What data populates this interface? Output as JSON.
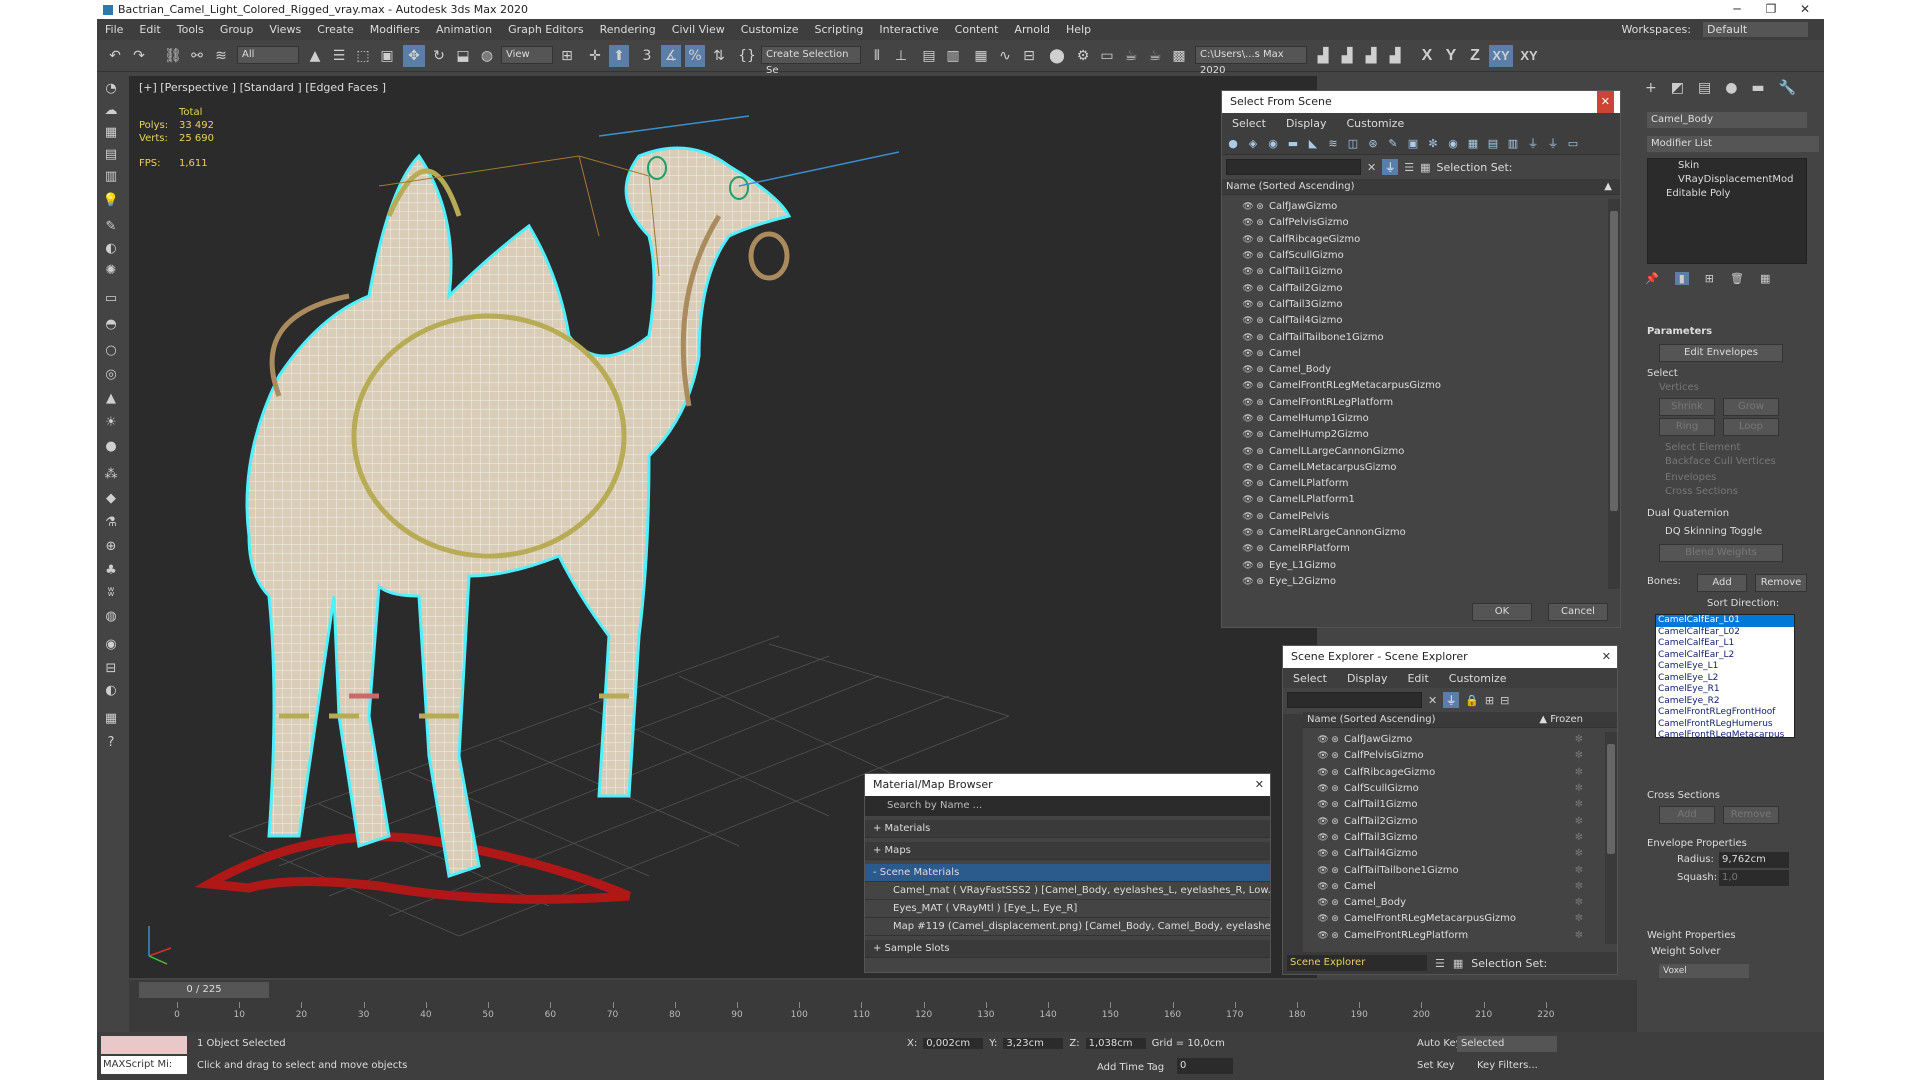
{
  "window": {
    "title": "Bactrian_Camel_Light_Colored_Rigged_vray.max - Autodesk 3ds Max 2020",
    "min": "─",
    "max": "❐",
    "close": "✕"
  },
  "menu": [
    "File",
    "Edit",
    "Tools",
    "Group",
    "Views",
    "Create",
    "Modifiers",
    "Animation",
    "Graph Editors",
    "Rendering",
    "Civil View",
    "Customize",
    "Scripting",
    "Interactive",
    "Content",
    "Arnold",
    "Help"
  ],
  "workspace": {
    "label": "Workspaces:",
    "value": "Default"
  },
  "toolbar": {
    "filter": "All",
    "refcoord": "View",
    "selset": "Create Selection Se",
    "path": "C:\\Users\\...s Max 2020",
    "axes": [
      "X",
      "Y",
      "Z",
      "XY",
      "XY"
    ]
  },
  "viewport": {
    "label": "[+] [Perspective ] [Standard ] [Edged Faces ]",
    "stats": {
      "total": "Total",
      "polys_k": "Polys:",
      "polys": "33 492",
      "verts_k": "Verts:",
      "verts": "25 690",
      "fps_k": "FPS:",
      "fps": "1,611"
    }
  },
  "select_from_scene": {
    "title": "Select From Scene",
    "menu": [
      "Select",
      "Display",
      "Customize"
    ],
    "selection_set": "Selection Set:",
    "col": "Name (Sorted Ascending)",
    "ok": "OK",
    "cancel": "Cancel",
    "items": [
      "CalfJawGizmo",
      "CalfPelvisGizmo",
      "CalfRibcageGizmo",
      "CalfScullGizmo",
      "CalfTail1Gizmo",
      "CalfTail2Gizmo",
      "CalfTail3Gizmo",
      "CalfTail4Gizmo",
      "CalfTailTailbone1Gizmo",
      "Camel",
      "Camel_Body",
      "CamelFrontRLegMetacarpusGizmo",
      "CamelFrontRLegPlatform",
      "CamelHump1Gizmo",
      "CamelHump2Gizmo",
      "CamelLLargeCannonGizmo",
      "CamelLMetacarpusGizmo",
      "CamelLPlatform",
      "CamelLPlatform1",
      "CamelPelvis",
      "CamelRLargeCannonGizmo",
      "CamelRPlatform",
      "Eye_L1Gizmo",
      "Eye_L2Gizmo"
    ]
  },
  "scene_explorer": {
    "title": "Scene Explorer - Scene Explorer",
    "menu": [
      "Select",
      "Display",
      "Edit",
      "Customize"
    ],
    "col": "Name (Sorted Ascending)",
    "frozen": "▲ Frozen",
    "footer": "Scene Explorer",
    "selection_set": "Selection Set:",
    "items": [
      "CalfJawGizmo",
      "CalfPelvisGizmo",
      "CalfRibcageGizmo",
      "CalfScullGizmo",
      "CalfTail1Gizmo",
      "CalfTail2Gizmo",
      "CalfTail3Gizmo",
      "CalfTail4Gizmo",
      "CalfTailTailbone1Gizmo",
      "Camel",
      "Camel_Body",
      "CamelFrontRLegMetacarpusGizmo",
      "CamelFrontRLegPlatform"
    ]
  },
  "material_browser": {
    "title": "Material/Map Browser",
    "search": "Search by Name ...",
    "materials": "+ Materials",
    "maps": "+ Maps",
    "scene_materials": "- Scene Materials",
    "sample_slots": "+ Sample Slots",
    "rows": [
      "Camel_mat  ( VRayFastSSS2 ) [Camel_Body, eyelashes_L, eyelashes_R, Low...",
      "Eyes_MAT  ( VRayMtl ) [Eye_L, Eye_R]",
      "Map #119 (Camel_displacement.png) [Camel_Body, Camel_Body, eyelashes..."
    ]
  },
  "command_panel": {
    "object": "Camel_Body",
    "modifier_list": "Modifier List",
    "stack": [
      "Skin",
      "VRayDisplacementMod",
      "Editable Poly"
    ],
    "parameters": "Parameters",
    "edit_envelopes": "Edit Envelopes",
    "select": "Select",
    "vertices": "Vertices",
    "shrink": "Shrink",
    "grow": "Grow",
    "ring": "Ring",
    "loop": "Loop",
    "select_element": "Select Element",
    "backface": "Backface Cull Vertices",
    "envelopes": "Envelopes",
    "cross_sections": "Cross Sections",
    "dual_quat": "Dual Quaternion",
    "dq_toggle": "DQ Skinning Toggle",
    "blend_weights": "Blend Weights",
    "bones": "Bones:",
    "add": "Add",
    "remove": "Remove",
    "sort_direction": "Sort Direction:",
    "bone_list": [
      "CamelCalfEar_L01",
      "CamelCalfEar_L02",
      "CamelCalfEar_L1",
      "CamelCalfEar_L2",
      "CamelEye_L1",
      "CamelEye_L2",
      "CamelEye_R1",
      "CamelEye_R2",
      "CamelFrontRLegFrontHoof",
      "CamelFrontRLegHumerus",
      "CamelFrontRLegMetacarpus"
    ],
    "cross_sections_title": "Cross Sections",
    "envelope_props": "Envelope Properties",
    "radius_k": "Radius:",
    "radius": "9,762cm",
    "squash_k": "Squash:",
    "squash": "1,0",
    "weight_props": "Weight Properties",
    "weight_solver": "Weight Solver",
    "voxel": "Voxel"
  },
  "timeline": {
    "frame": "0 / 225",
    "ticks": [
      "0",
      "10",
      "20",
      "30",
      "40",
      "50",
      "60",
      "70",
      "80",
      "90",
      "100",
      "110",
      "120",
      "130",
      "140",
      "150",
      "160",
      "170",
      "180",
      "190",
      "200",
      "210",
      "220"
    ]
  },
  "status": {
    "script": "MAXScript Mi:",
    "selected": "1 Object Selected",
    "hint": "Click and drag to select and move objects",
    "x_k": "X:",
    "x": "0,002cm",
    "y_k": "Y:",
    "y": "3,23cm",
    "z_k": "Z:",
    "z": "1,038cm",
    "grid": "Grid = 10,0cm",
    "add_time_tag": "Add Time Tag",
    "auto_key": "Auto Key",
    "set_key": "Set Key",
    "key_mode": "Selected",
    "key_filters": "Key Filters...",
    "frame_input": "0"
  }
}
